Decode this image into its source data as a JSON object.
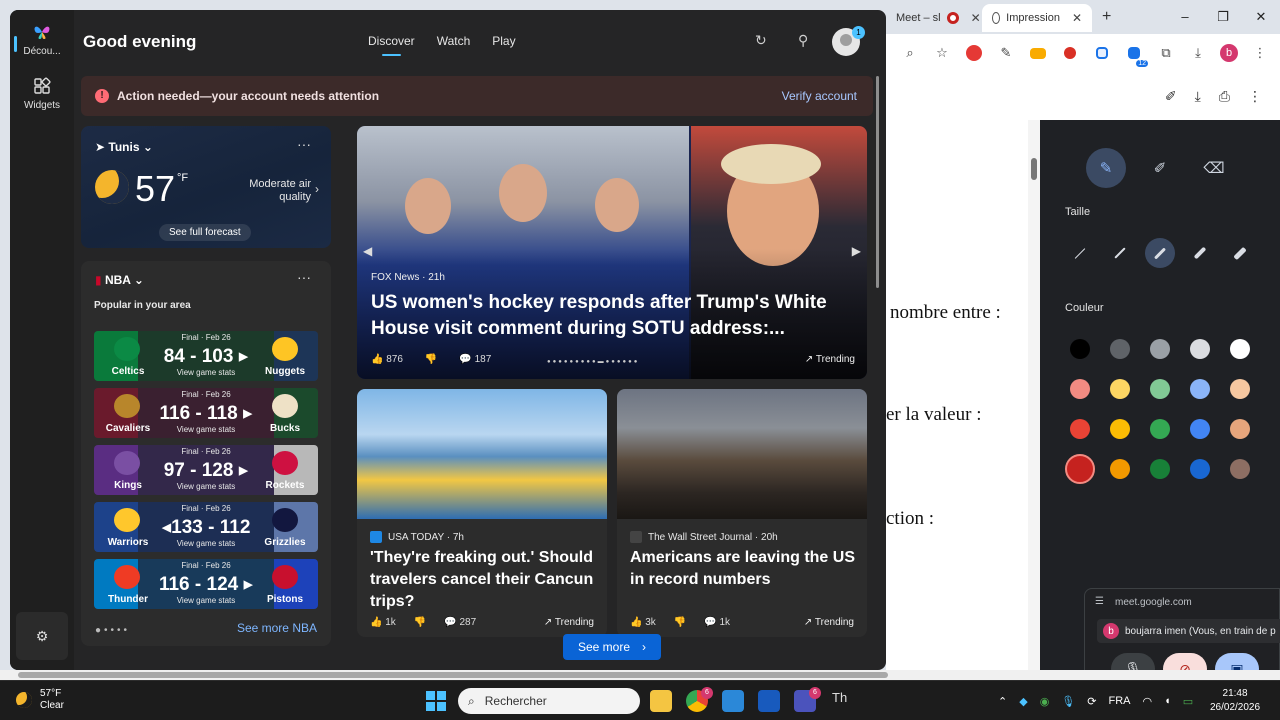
{
  "chrome": {
    "tabs": [
      {
        "label": "Meet – sl",
        "active": false
      },
      {
        "label": "Impression",
        "active": true
      }
    ],
    "new_tab_icon": "plus-icon",
    "window_controls": [
      "–",
      "❐",
      "✕"
    ],
    "toolbar_icons": [
      "zoom-icon",
      "star-icon",
      "extension-red-icon",
      "eyedropper-icon",
      "extension-folder-icon",
      "extension-badge-icon",
      "extension-blue-icon",
      "extension-12-icon",
      "puzzle-icon",
      "download-icon"
    ],
    "toolbar_badge": "12",
    "profile_initial": "b",
    "pdf_toolbar_icons": [
      "add-annotation-icon",
      "download-icon",
      "print-icon",
      "more-icon"
    ]
  },
  "pdf": {
    "lines": [
      "nombre entre :",
      "er la valeur :",
      "ction :"
    ]
  },
  "annotation": {
    "tools": [
      "pen-icon",
      "highlighter-icon",
      "eraser-icon"
    ],
    "size_label": "Taille",
    "color_label": "Couleur",
    "selected_size": 3,
    "colors": [
      [
        "#000000",
        "#5f6368",
        "#9aa0a6",
        "#dadce0",
        "#ffffff"
      ],
      [
        "#f28b82",
        "#fdd663",
        "#81c995",
        "#8ab4f8",
        "#f6c7a0"
      ],
      [
        "#ea4335",
        "#fbbc04",
        "#34a853",
        "#4285f4",
        "#e6a57c"
      ],
      [
        "#c5221f",
        "#f29900",
        "#188038",
        "#1967d2",
        "#8d6e63"
      ]
    ]
  },
  "meet": {
    "url": "meet.google.com",
    "participant_initial": "b",
    "participant": "boujarra imen (Vous, en train de p",
    "controls": [
      "mic-icon",
      "camera-off-icon",
      "present-icon"
    ]
  },
  "rail": {
    "discover_label": "Décou...",
    "widgets_label": "Widgets",
    "settings_icon": "gear-icon"
  },
  "header": {
    "greeting": "Good evening",
    "nav": [
      "Discover",
      "Watch",
      "Play"
    ],
    "active_nav": "Discover",
    "avatar_badge": "1"
  },
  "alert": {
    "text": "Action needed—your account needs attention",
    "action": "Verify account"
  },
  "weather": {
    "location": "Tunis",
    "temp": "57",
    "unit": "°F",
    "condition_icon": "moon-icon",
    "air_quality": "Moderate air quality",
    "forecast_button": "See full forecast"
  },
  "nba": {
    "title": "NBA",
    "subtitle": "Popular in your area",
    "see_more": "See more NBA",
    "games": [
      {
        "status": "Final · Feb 26",
        "score": "84 - 103 ▸",
        "stats": "View game stats",
        "home": "Celtics",
        "away": "Nuggets",
        "home_color": "#0a7a3b",
        "away_color": "#1d3557",
        "home_logo": "#0b8a45",
        "away_logo": "#fec524"
      },
      {
        "status": "Final · Feb 26",
        "score": "116 - 118 ▸",
        "stats": "View game stats",
        "home": "Cavaliers",
        "away": "Bucks",
        "home_color": "#6a1a2c",
        "away_color": "#1b4a2c",
        "home_logo": "#b8862b",
        "away_logo": "#eee1c6"
      },
      {
        "status": "Final · Feb 26",
        "score": "97 - 128 ▸",
        "stats": "View game stats",
        "home": "Kings",
        "away": "Rockets",
        "home_color": "#5a2d82",
        "away_color": "#b8b8b8",
        "home_logo": "#7a4fa3",
        "away_logo": "#ce1141"
      },
      {
        "status": "Final · Feb 26",
        "score": "◂133 - 112",
        "stats": "View game stats",
        "home": "Warriors",
        "away": "Grizzlies",
        "home_color": "#1d428a",
        "away_color": "#5d76a9",
        "home_logo": "#ffc72c",
        "away_logo": "#12173f"
      },
      {
        "status": "Final · Feb 26",
        "score": "116 - 124 ▸",
        "stats": "View game stats",
        "home": "Thunder",
        "away": "Pistons",
        "home_color": "#007ac1",
        "away_color": "#1d42ba",
        "home_logo": "#ef3b24",
        "away_logo": "#c8102e"
      }
    ]
  },
  "hero": {
    "source": "FOX News · 21h",
    "title": "US women's hockey responds after Trump's White House visit comment during SOTU address:...",
    "likes": "876",
    "comments": "187",
    "trending": "Trending"
  },
  "cards": [
    {
      "source": "USA TODAY · 7h",
      "title": "'They're freaking out.' Should travelers cancel their Cancun trips?",
      "likes": "1k",
      "comments": "287",
      "trending": "Trending",
      "src_color": "#1e88e5"
    },
    {
      "source": "The Wall Street Journal · 20h",
      "title": "Americans are leaving the US in record numbers",
      "likes": "3k",
      "comments": "1k",
      "trending": "Trending",
      "src_color": "#222222"
    }
  ],
  "see_more": "See more",
  "taskbar": {
    "weather_temp": "57°F",
    "weather_cond": "Clear",
    "search_placeholder": "Rechercher",
    "apps": [
      "file-explorer-icon",
      "chrome-icon",
      "store-icon",
      "word-icon",
      "teams-icon",
      "th-icon"
    ],
    "badge_count": "6",
    "language": "FRA",
    "time": "21:48",
    "date": "26/02/2026"
  }
}
